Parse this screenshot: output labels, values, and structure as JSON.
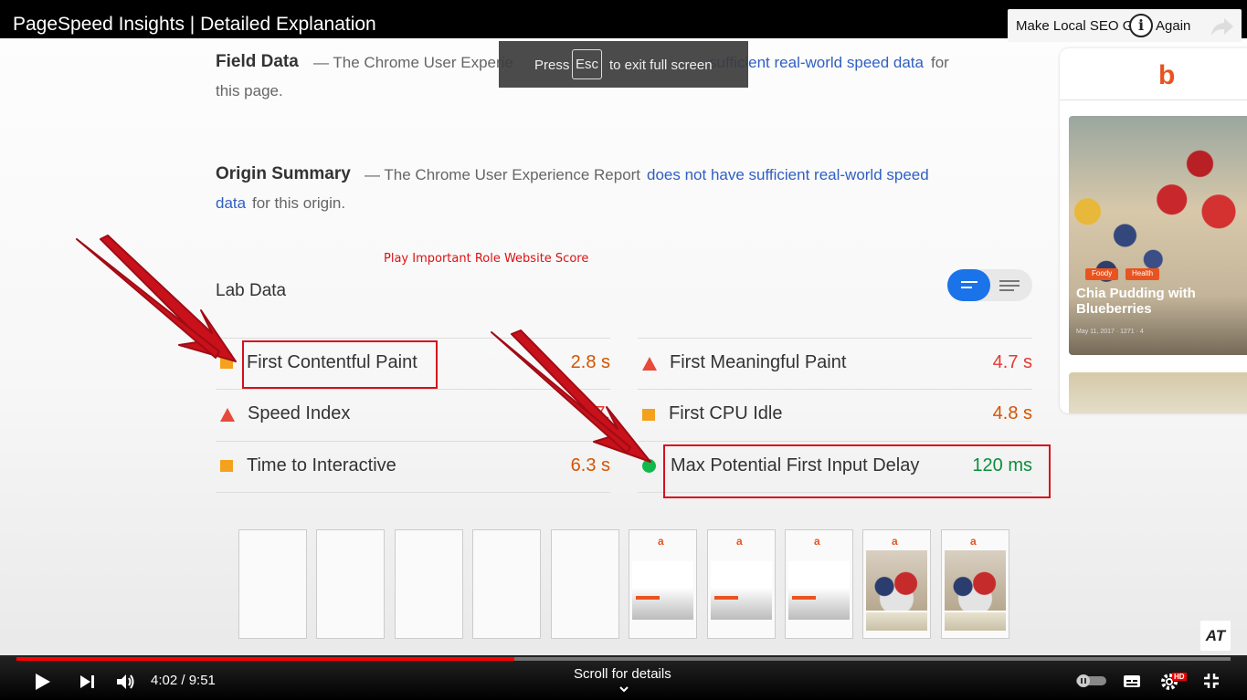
{
  "video": {
    "title": "PageSpeed Insights | Detailed Explanation",
    "top_right_label_a": "Make Local SEO G",
    "top_right_label_b": "Again"
  },
  "esc_toast": {
    "press": "Press",
    "key": "Esc",
    "suffix": "to exit full screen"
  },
  "page": {
    "field_data": {
      "heading": "Field Data",
      "text_a": "— The Chrome User Experie",
      "link": "sufficient real-world speed data",
      "text_b": "for",
      "text_c": "this page."
    },
    "origin_summary": {
      "heading": "Origin Summary",
      "text_a": "— The Chrome User Experience Report",
      "link_a": "does not have sufficient real-world speed",
      "link_b": "data",
      "text_b": "for this origin."
    },
    "annotation": "Play Important Role Website Score",
    "lab_data": {
      "heading": "Lab Data",
      "metrics_left": [
        {
          "label": "First Contentful Paint",
          "value": "2.8 s",
          "status": "average"
        },
        {
          "label": "Speed Index",
          "value": "7.",
          "status": "slow"
        },
        {
          "label": "Time to Interactive",
          "value": "6.3 s",
          "status": "average"
        }
      ],
      "metrics_right": [
        {
          "label": "First Meaningful Paint",
          "value": "4.7 s",
          "status": "slow"
        },
        {
          "label": "First CPU Idle",
          "value": "4.8 s",
          "status": "average"
        },
        {
          "label": "Max Potential First Input Delay",
          "value": "120 ms",
          "status": "fast"
        }
      ]
    },
    "side_card": {
      "logo": "b",
      "tags": [
        "Foody",
        "Health"
      ],
      "title": "Chia Pudding with Blueberries",
      "meta": "May 11, 2017  ·  1271  ·  4"
    },
    "filmstrip_logo": "a",
    "watermark": "AT"
  },
  "player": {
    "time": "4:02 / 9:51",
    "progress": 0.41,
    "scroll_hint": "Scroll for details",
    "hd_badge": "HD"
  },
  "colors": {
    "link": "#2f5fc4",
    "average": "#d35400",
    "slow": "#e53935",
    "fast": "#0a8f3c",
    "annotation": "#d6101b",
    "progress": "#ff0000"
  }
}
